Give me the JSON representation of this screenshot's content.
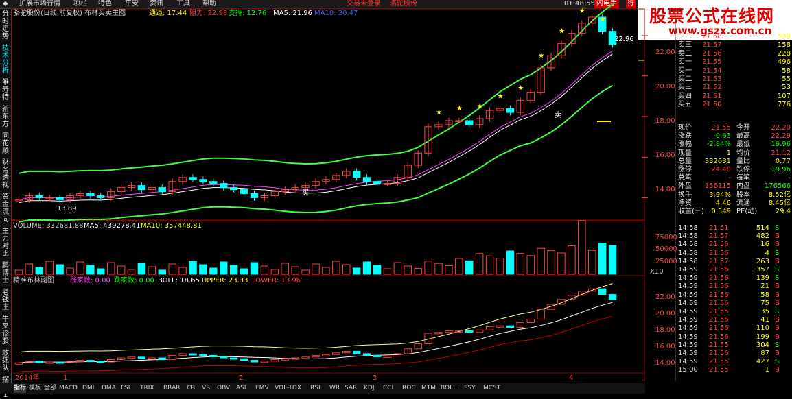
{
  "menu": {
    "items": [
      "扩展市场行情",
      "项栏",
      "特色",
      "平安",
      "资讯",
      "工具",
      "帮助"
    ],
    "notice": "交易未登录",
    "stock": "骆驼股份",
    "time": "01:48:55 周五",
    "btn_flash": "闪电手",
    "btn_trade": "行"
  },
  "watermark": {
    "line1": "股票公式在线网",
    "line2": "www.gszx.com.cn"
  },
  "left_tabs": [
    {
      "label": "分时走势",
      "active": false
    },
    {
      "label": "技术分析",
      "active": true
    },
    {
      "label": "雏寿特",
      "active": false
    },
    {
      "label": "新东方",
      "active": false
    },
    {
      "label": "同花顺",
      "active": false
    },
    {
      "label": "财务透视",
      "active": false
    },
    {
      "label": "资金流向",
      "active": false
    },
    {
      "label": "主力对比",
      "active": false
    },
    {
      "label": "鹏博士",
      "active": false
    },
    {
      "label": "老钱庄",
      "active": false
    },
    {
      "label": "牛叉诊股",
      "active": false
    },
    {
      "label": "敢死队",
      "active": false
    },
    {
      "label": "摆渡1",
      "active": false
    }
  ],
  "main_chart": {
    "title": "骆驼股份(日线,前复权) 布林买卖主图",
    "channel": "通道: 17.44",
    "resist": "阻力: 22.98",
    "support": "支持: 12.76",
    "ma5": "MA5: 21.96",
    "ma10": "MA10: 20.47",
    "high_label": "22.96",
    "low_label": "13.89",
    "sell_label": "卖",
    "buy_label": "买",
    "axis": [
      "22.00",
      "20.00",
      "18.00",
      "16.00",
      "14.00"
    ]
  },
  "volume_chart": {
    "volume": "VOLUME: 332681.88",
    "ma5": "MA5: 439278.41",
    "ma10": "MA10: 357448.81",
    "axis": [
      "75000",
      "50000",
      "25000"
    ],
    "unit": "X10"
  },
  "sub_chart": {
    "title": "精准布林副图",
    "up": "涨家数: 0.00",
    "down": "跌家数: 0.00",
    "boll": "BOLL: 18.65",
    "upper": "UPPER: 23.33",
    "lower": "LOWER: 13.96",
    "axis": [
      "22.00",
      "20.00",
      "18.00",
      "16.00",
      "14.00"
    ]
  },
  "date_axis": [
    "2014年",
    "1",
    "2",
    "3",
    "4"
  ],
  "order_book": [
    {
      "label": "卖四",
      "price": "21.58",
      "vol": "539"
    },
    {
      "label": "卖三",
      "price": "21.57",
      "vol": "158"
    },
    {
      "label": "卖二",
      "price": "21.56",
      "vol": "228"
    },
    {
      "label": "卖一",
      "price": "21.55",
      "vol": "496"
    },
    {
      "label": "买一",
      "price": "21.54",
      "vol": "58"
    },
    {
      "label": "买二",
      "price": "21.53",
      "vol": "55"
    },
    {
      "label": "买三",
      "price": "21.52",
      "vol": "53"
    },
    {
      "label": "买四",
      "price": "21.51",
      "vol": "107"
    },
    {
      "label": "买五",
      "price": "21.50",
      "vol": "776"
    }
  ],
  "stats": [
    {
      "l1": "现价",
      "v1": "21.55",
      "c1": "#ff4040",
      "l2": "今开",
      "v2": "22.20",
      "c2": "#ff4040"
    },
    {
      "l1": "涨跌",
      "v1": "-0.63",
      "c1": "#00ff00",
      "l2": "最高",
      "v2": "22.29",
      "c2": "#ff4040"
    },
    {
      "l1": "涨幅",
      "v1": "-2.84%",
      "c1": "#00ff00",
      "l2": "最低",
      "v2": "19.96",
      "c2": "#00ff00"
    },
    {
      "l1": "现量",
      "v1": "1",
      "c1": "#ffff00",
      "l2": "均价",
      "v2": "21.12",
      "c2": "#ff4040"
    },
    {
      "l1": "总量",
      "v1": "332681",
      "c1": "#ffff00",
      "l2": "量比",
      "v2": "0.77",
      "c2": "#ffff00"
    },
    {
      "l1": "涨停",
      "v1": "24.40",
      "c1": "#ff4040",
      "l2": "跌停",
      "v2": "19.96",
      "c2": "#00ff00"
    },
    {
      "l1": "总笔",
      "v1": "-",
      "c1": "#c0c0c0",
      "l2": "每笔",
      "v2": "-",
      "c2": "#c0c0c0"
    },
    {
      "l1": "外盘",
      "v1": "156115",
      "c1": "#ff4040",
      "l2": "内盘",
      "v2": "176566",
      "c2": "#00ff00"
    },
    {
      "l1": "换手",
      "v1": "3.94%",
      "c1": "#ffff00",
      "l2": "股本",
      "v2": "8.52亿",
      "c2": "#ffff00"
    },
    {
      "l1": "净资",
      "v1": "4.46",
      "c1": "#ffff00",
      "l2": "流通",
      "v2": "8.45亿",
      "c2": "#ffff00"
    },
    {
      "l1": "收益(三)",
      "v1": "0.549",
      "c1": "#ffff00",
      "l2": "PE(动)",
      "v2": "29.4",
      "c2": "#ffff00"
    }
  ],
  "ticks": [
    {
      "t": "14:58",
      "p": "21.51",
      "v": "514",
      "bs": "S"
    },
    {
      "t": "14:58",
      "p": "21.57",
      "v": "482",
      "bs": "B"
    },
    {
      "t": "14:58",
      "p": "21.56",
      "v": "16",
      "bs": "B"
    },
    {
      "t": "14:58",
      "p": "21.56",
      "v": "4",
      "bs": "S"
    },
    {
      "t": "14:58",
      "p": "21.57",
      "v": "263",
      "bs": "B"
    },
    {
      "t": "14:59",
      "p": "21.56",
      "v": "357",
      "bs": "S"
    },
    {
      "t": "14:59",
      "p": "21.56",
      "v": "139",
      "bs": "S"
    },
    {
      "t": "14:59",
      "p": "21.56",
      "v": "21",
      "bs": "B"
    },
    {
      "t": "14:59",
      "p": "21.56",
      "v": "58",
      "bs": "B"
    },
    {
      "t": "14:59",
      "p": "21.56",
      "v": "75",
      "bs": "B"
    },
    {
      "t": "14:59",
      "p": "21.55",
      "v": "35",
      "bs": "S"
    },
    {
      "t": "14:59",
      "p": "21.56",
      "v": "41",
      "bs": "B"
    },
    {
      "t": "14:59",
      "p": "21.56",
      "v": "110",
      "bs": "B"
    },
    {
      "t": "14:59",
      "p": "21.56",
      "v": "199",
      "bs": "B"
    },
    {
      "t": "14:59",
      "p": "21.55",
      "v": "304",
      "bs": "S"
    },
    {
      "t": "14:59",
      "p": "21.56",
      "v": "87",
      "bs": "B"
    },
    {
      "t": "14:59",
      "p": "21.55",
      "v": "427",
      "bs": "S"
    },
    {
      "t": "15:00",
      "p": "21.55",
      "v": "1",
      "bs": "B"
    }
  ],
  "bottom_tabs": [
    {
      "label": "指标",
      "active": true
    },
    {
      "label": "模板",
      "active": false
    },
    {
      "label": "全部",
      "active": false
    },
    {
      "label": "MACD",
      "active": false
    },
    {
      "label": "DMI",
      "active": false
    },
    {
      "label": "DMA",
      "active": false
    },
    {
      "label": "FSL",
      "active": false
    },
    {
      "label": "TRIX",
      "active": false
    },
    {
      "label": "BRAR",
      "active": false
    },
    {
      "label": "CR",
      "active": false
    },
    {
      "label": "VR",
      "active": false
    },
    {
      "label": "OBV",
      "active": false
    },
    {
      "label": "ASI",
      "active": false
    },
    {
      "label": "EMV",
      "active": false
    },
    {
      "label": "VOL-TDX",
      "active": false
    },
    {
      "label": "RSI",
      "active": false
    },
    {
      "label": "WR",
      "active": false
    },
    {
      "label": "SAR",
      "active": false
    },
    {
      "label": "KDJ",
      "active": false
    },
    {
      "label": "CCI",
      "active": false
    },
    {
      "label": "ROC",
      "active": false
    },
    {
      "label": "MTM",
      "active": false
    },
    {
      "label": "BOLL",
      "active": false
    },
    {
      "label": "PSY",
      "active": false
    },
    {
      "label": "MCST",
      "active": false
    }
  ],
  "chart_data": {
    "type": "candlestick",
    "closes": [
      13.9,
      14.1,
      14.0,
      14.0,
      13.9,
      14.1,
      14.2,
      14.1,
      14.0,
      14.3,
      14.5,
      14.6,
      14.4,
      14.5,
      14.3,
      14.8,
      15.0,
      14.9,
      14.8,
      14.7,
      14.5,
      14.4,
      14.2,
      14.0,
      14.1,
      14.3,
      14.4,
      14.5,
      14.6,
      14.8,
      14.9,
      15.1,
      15.3,
      15.0,
      14.8,
      14.7,
      14.7,
      15.0,
      15.6,
      16.2,
      17.5,
      17.6,
      17.8,
      17.8,
      17.6,
      17.9,
      18.3,
      18.4,
      18.2,
      18.8,
      19.2,
      20.4,
      21.0,
      21.6,
      22.1,
      22.6,
      22.9,
      22.2,
      21.55
    ],
    "ylim": [
      13,
      23
    ]
  }
}
